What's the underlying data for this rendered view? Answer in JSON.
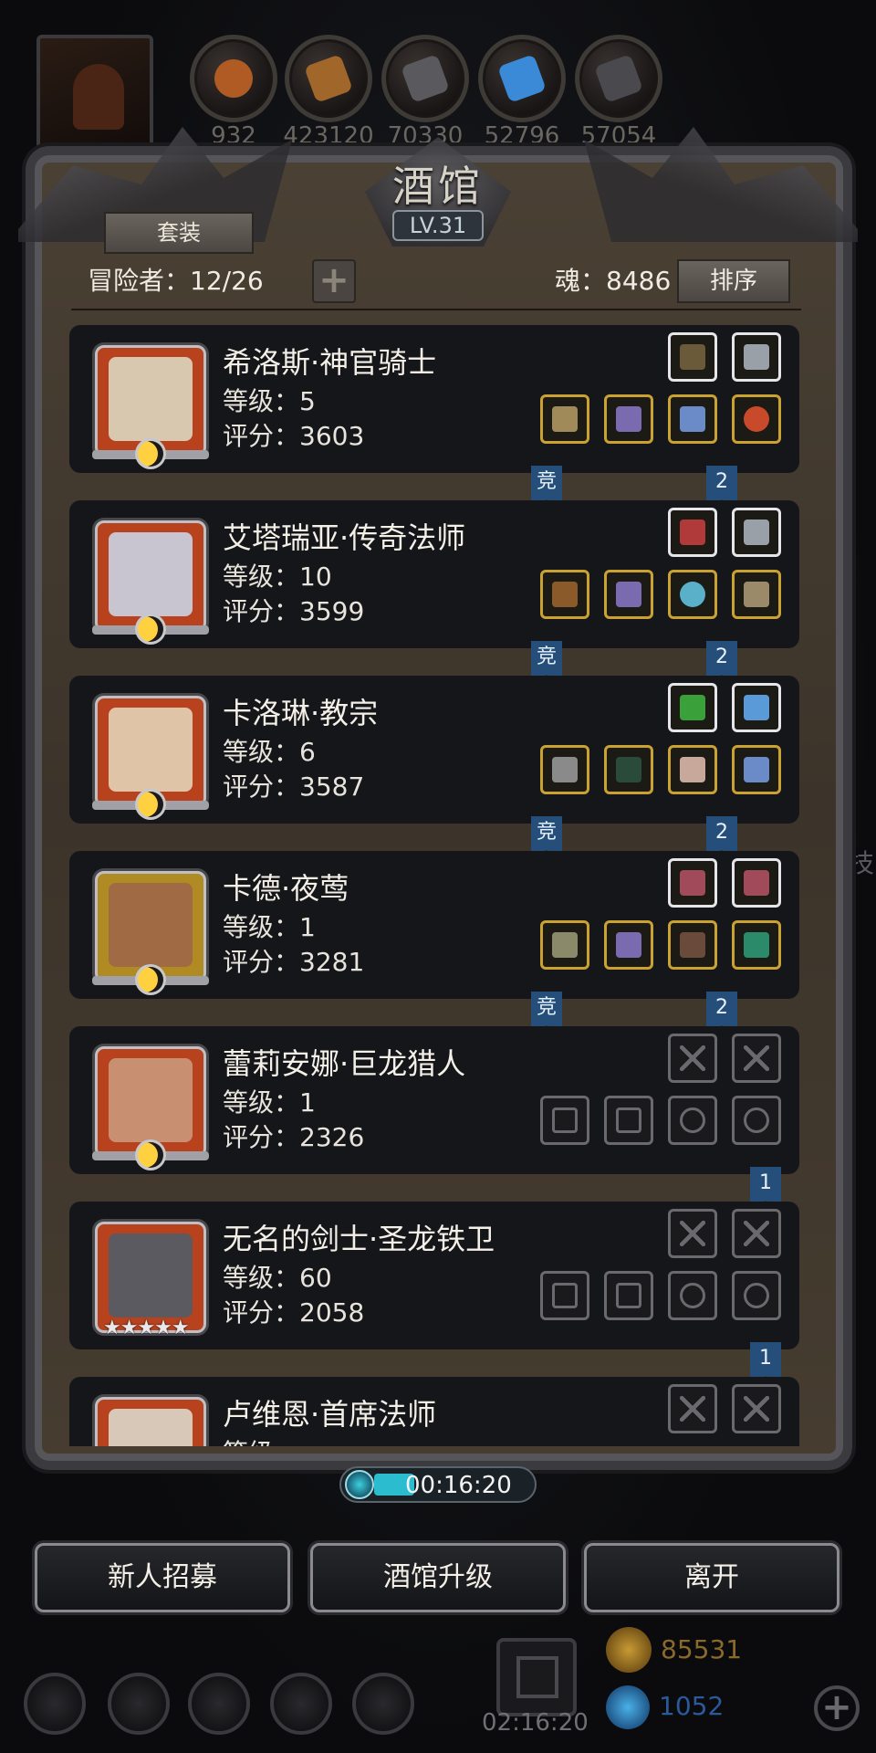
{
  "resources": [
    {
      "icon": "food-icon",
      "value": "932",
      "color": "#b05a24"
    },
    {
      "icon": "wood-icon",
      "value": "423120",
      "color": "#a0662a"
    },
    {
      "icon": "stone-icon",
      "value": "70330",
      "color": "#5a5a5e"
    },
    {
      "icon": "crystal-icon",
      "value": "52796",
      "color": "#3a8ad8"
    },
    {
      "icon": "iron-icon",
      "value": "57054",
      "color": "#4a4a4e"
    }
  ],
  "tavern": {
    "title": "酒馆",
    "level": "LV.31",
    "set_label": "套装",
    "adventurers_label": "冒险者：12/26",
    "add_label": "+",
    "soul_label": "魂：8486",
    "sort_label": "排序"
  },
  "heroes": [
    {
      "name": "希洛斯·神官骑士",
      "level": "等级：5",
      "score": "评分：3603",
      "frame": "red",
      "has_moon": true,
      "rank_flag": "竞",
      "team_flag": "2",
      "face": "#d8c8b0"
    },
    {
      "name": "艾塔瑞亚·传奇法师",
      "level": "等级：10",
      "score": "评分：3599",
      "frame": "red",
      "has_moon": true,
      "rank_flag": "竞",
      "team_flag": "2",
      "face": "#c8c4d0"
    },
    {
      "name": "卡洛琳·教宗",
      "level": "等级：6",
      "score": "评分：3587",
      "frame": "red",
      "has_moon": true,
      "rank_flag": "竞",
      "team_flag": "2",
      "face": "#e0c4a8"
    },
    {
      "name": "卡德·夜莺",
      "level": "等级：1",
      "score": "评分：3281",
      "frame": "gold",
      "has_moon": true,
      "rank_flag": "竞",
      "team_flag": "2",
      "face": "#a06a44"
    },
    {
      "name": "蕾莉安娜·巨龙猎人",
      "level": "等级：1",
      "score": "评分：2326",
      "frame": "red",
      "has_moon": true,
      "rank_flag": "",
      "team_flag": "1",
      "face": "#c89070"
    },
    {
      "name": "无名的剑士·圣龙铁卫",
      "level": "等级：60",
      "score": "评分：2058",
      "frame": "red",
      "stars": "★★★★★",
      "rank_flag": "",
      "team_flag": "1",
      "face": "#5a5a60"
    },
    {
      "name": "卢维恩·首席法师",
      "level": "等级",
      "score": "",
      "frame": "red",
      "rank_flag": "",
      "team_flag": "",
      "face": "#d8c8b8"
    }
  ],
  "timer": "00:16:20",
  "buttons": {
    "recruit": "新人招募",
    "upgrade": "酒馆升级",
    "leave": "离开"
  },
  "hud": {
    "gift_timer": "02:16:20",
    "gold": "85531",
    "gems": "1052",
    "add": "+",
    "side_text": "技"
  },
  "colors": {
    "frame_gold": "#c9a232",
    "frame_white": "#e6e6ea",
    "flag_blue": "#254f7a"
  }
}
